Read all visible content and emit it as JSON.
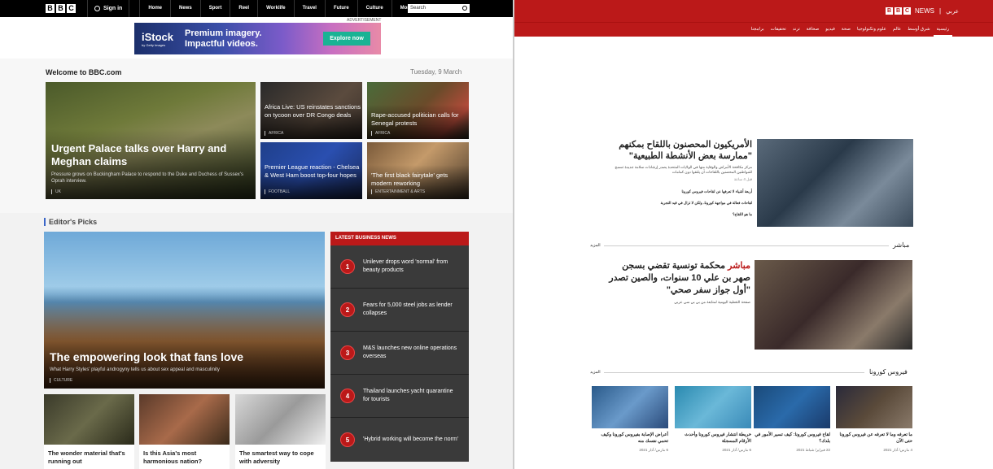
{
  "bbc": {
    "nav": {
      "logo": [
        "B",
        "B",
        "C"
      ],
      "signin": "Sign in",
      "links": [
        "Home",
        "News",
        "Sport",
        "Reel",
        "Worklife",
        "Travel",
        "Future",
        "Culture",
        "More"
      ],
      "search_placeholder": "Search"
    },
    "ad": {
      "label": "ADVERTISEMENT",
      "brand": "iStock",
      "brand_sub": "by Getty Images",
      "tagline_1": "Premium imagery.",
      "tagline_2": "Impactful videos.",
      "cta": "Explore now"
    },
    "welcome": "Welcome to BBC.com",
    "date": "Tuesday, 9 March",
    "top_stories": [
      {
        "headline": "Urgent Palace talks over Harry and Meghan claims",
        "summary": "Pressure grows on Buckingham Palace to respond to the Duke and Duchess of Sussex's Oprah interview.",
        "category": "UK"
      },
      {
        "headline": "Africa Live: US reinstates sanctions on tycoon over DR Congo deals",
        "category": "AFRICA"
      },
      {
        "headline": "Rape-accused politician calls for Senegal protests",
        "category": "AFRICA"
      },
      {
        "headline": "Premier League reaction - Chelsea & West Ham boost top-four hopes",
        "category": "FOOTBALL"
      },
      {
        "headline": "'The first black fairytale' gets modern reworking",
        "category": "ENTERTAINMENT & ARTS"
      }
    ],
    "editors_picks": {
      "title": "Editor's Picks",
      "main": {
        "headline": "The empowering look that fans love",
        "summary": "What Harry Styles' playful androgyny tells us about sex appeal and masculinity",
        "category": "CULTURE"
      },
      "small": [
        {
          "headline": "The wonder material that's running out"
        },
        {
          "headline": "Is this Asia's most harmonious nation?"
        },
        {
          "headline": "The smartest way to cope with adversity"
        }
      ]
    },
    "business": {
      "title": "LATEST BUSINESS NEWS",
      "items": [
        {
          "num": "1",
          "text": "Unilever drops word 'normal' from beauty products"
        },
        {
          "num": "2",
          "text": "Fears for 5,000 steel jobs as lender collapses"
        },
        {
          "num": "3",
          "text": "M&S launches new online operations overseas"
        },
        {
          "num": "4",
          "text": "Thailand launches yacht quarantine for tourists"
        },
        {
          "num": "5",
          "text": "'Hybrid working will become the norm'"
        }
      ]
    }
  },
  "arabic": {
    "logo": [
      "B",
      "B",
      "C"
    ],
    "logo_news": "NEWS",
    "logo_lang": "عربي",
    "nav": [
      "رئيسية",
      "شرق أوسط",
      "عالم",
      "علوم وتكنولوجيا",
      "صحة",
      "فيديو",
      "صحافة",
      "ترند",
      "تحقيقات",
      "برامجنا"
    ],
    "lead": {
      "headline": "الأمريكيون المحصنون باللقاح بمكنهم \"ممارسة بعض الأنشطة الطبيعية\"",
      "summary": "مركز مكافحة الأمراض والوقاية منها في الولايات المتحدة يصدر إرشادات سلامة جديدة تسمح للمواطنين المحصنين باللقاحات أن يلتقوا دون كمامات",
      "time": "قبل 4 ساعة",
      "related": [
        "أربعة أشياء لا تعرفها عن لقاحات فيروس كورونا",
        "لقاحات فعالة في مواجهة كورونا، ولكن لا تزال في قيد التجربة",
        "ما هو اللقاح؟"
      ]
    },
    "live": {
      "label": "مباشر",
      "more": "المزيد",
      "headline_prefix": "مباشر",
      "headline": "محكمة تونسية تقضي بسجن صهر بن علي 10 سنوات، والصين تصدر \"أول جواز سفر صحي\"",
      "summary": "صفحة التغطية اليومية لمتابعة من بي بي سي عربي"
    },
    "corona": {
      "label": "فيروس كورونا",
      "more": "المزيد",
      "cards": [
        {
          "title": "ما تعرفه وما لا تعرفه عن فيروس كورونا حتى الآن",
          "date": "4 مارس/ آذار 2021"
        },
        {
          "title": "لقاح فيروس كورونا: كيف تسير الأمور في بلدك؟",
          "date": "22 فبراير/ شباط 2021"
        },
        {
          "title": "خريطة انتشار فيروس كورونا وأحدث الأرقام المسجلة",
          "date": "6 مارس/ آذار 2021"
        },
        {
          "title": "أعراض الإصابة بفيروس كورونا وكيف تحمي نفسك منه",
          "date": "6 مارس/ آذار 2021"
        }
      ]
    }
  },
  "colors": {
    "bbc_red": "#bb1919",
    "accent_blue": "#3b66c8"
  }
}
